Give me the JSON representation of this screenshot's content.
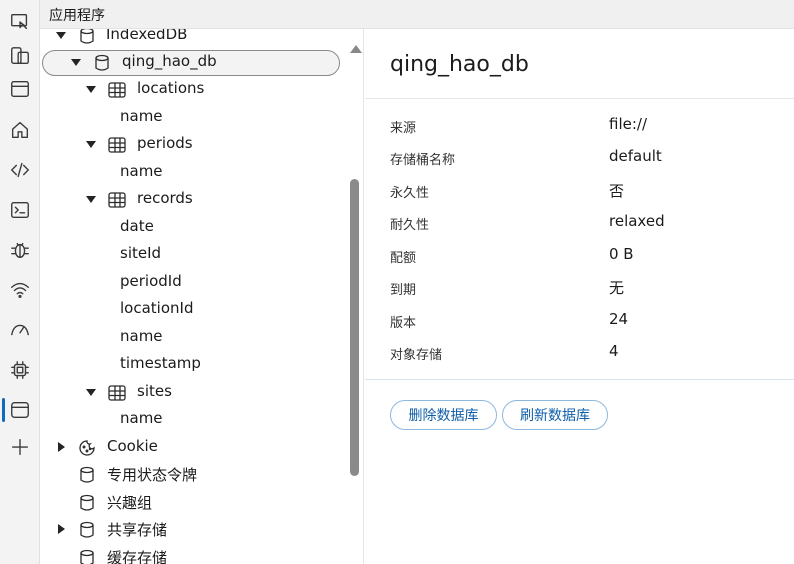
{
  "topbar": {
    "title": "应用程序"
  },
  "activity_bar": {
    "icons": [
      "inspect-icon",
      "device-emulation-icon",
      "window-icon",
      "home-icon",
      "code-icon",
      "console-icon",
      "bug-icon",
      "wifi-icon",
      "performance-icon",
      "cpu-icon",
      "application-icon",
      "add-icon"
    ],
    "active": "application-icon"
  },
  "tree": {
    "items": [
      {
        "label": "IndexedDB",
        "icon": "database-icon",
        "expanded": true
      },
      {
        "label": "qing_hao_db",
        "icon": "database-icon",
        "expanded": true,
        "selected": true
      },
      {
        "label": "locations",
        "icon": "table-icon",
        "expanded": true
      },
      {
        "label": "name"
      },
      {
        "label": "periods",
        "icon": "table-icon",
        "expanded": true
      },
      {
        "label": "name"
      },
      {
        "label": "records",
        "icon": "table-icon",
        "expanded": true
      },
      {
        "label": "date"
      },
      {
        "label": "siteId"
      },
      {
        "label": "periodId"
      },
      {
        "label": "locationId"
      },
      {
        "label": "name"
      },
      {
        "label": "timestamp"
      },
      {
        "label": "sites",
        "icon": "table-icon",
        "expanded": true
      },
      {
        "label": "name"
      },
      {
        "label": "Cookie",
        "icon": "cookie-icon",
        "expanded": false
      },
      {
        "label": "专用状态令牌",
        "icon": "database-icon"
      },
      {
        "label": "兴趣组",
        "icon": "database-icon"
      },
      {
        "label": "共享存储",
        "icon": "database-icon",
        "expanded": false
      },
      {
        "label": "缓存存储",
        "icon": "database-icon"
      }
    ]
  },
  "detail": {
    "title": "qing_hao_db",
    "properties": [
      {
        "key": "来源",
        "value": "file://"
      },
      {
        "key": "存储桶名称",
        "value": "default"
      },
      {
        "key": "永久性",
        "value": "否"
      },
      {
        "key": "耐久性",
        "value": "relaxed"
      },
      {
        "key": "配额",
        "value": "0 B"
      },
      {
        "key": "到期",
        "value": "无"
      },
      {
        "key": "版本",
        "value": "24"
      },
      {
        "key": "对象存储",
        "value": "4"
      }
    ],
    "buttons": {
      "delete": "删除数据库",
      "refresh": "刷新数据库"
    }
  },
  "colors": {
    "accent": "#0f6cbd",
    "button_text": "#0f5ea8",
    "button_border": "#8cb7de"
  }
}
